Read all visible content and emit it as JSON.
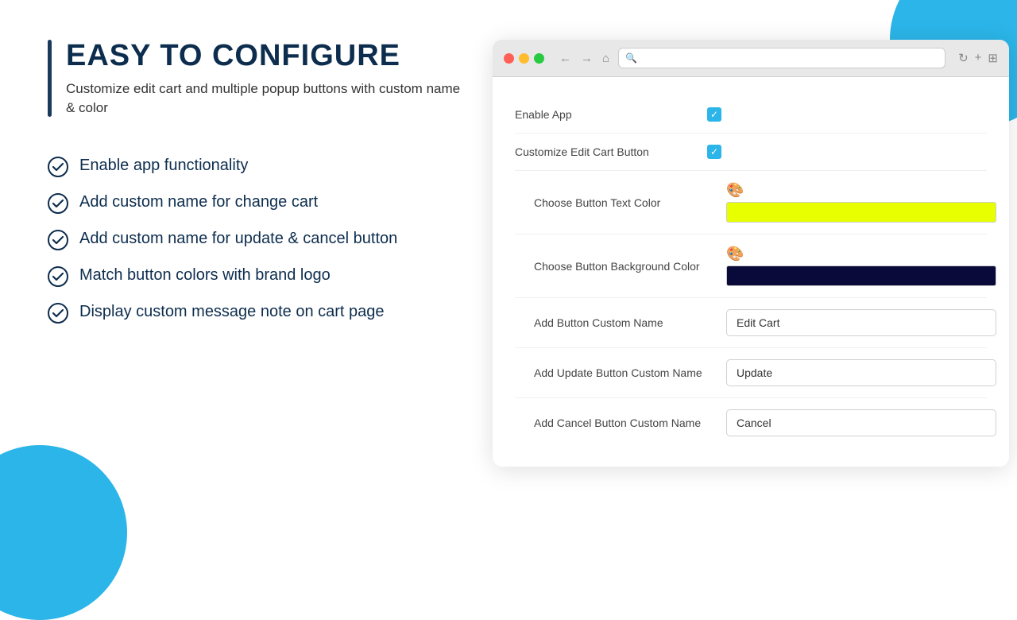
{
  "page": {
    "title": "Easy to Configure",
    "title_display": "EASY TO CONFIGURE",
    "subtitle": "Customize edit cart and multiple popup buttons with custom name & color"
  },
  "features": [
    {
      "id": 1,
      "text": "Enable app functionality"
    },
    {
      "id": 2,
      "text": "Add custom name for change cart"
    },
    {
      "id": 3,
      "text": "Add custom name for update & cancel button"
    },
    {
      "id": 4,
      "text": "Match button colors with brand logo"
    },
    {
      "id": 5,
      "text": "Display custom message note on cart page"
    }
  ],
  "form": {
    "enable_app_label": "Enable App",
    "customize_edit_cart_label": "Customize Edit Cart Button",
    "choose_text_color_label": "Choose Button Text Color",
    "choose_bg_color_label": "Choose Button Background Color",
    "add_button_name_label": "Add Button Custom Name",
    "add_update_name_label": "Add Update Button Custom Name",
    "add_cancel_name_label": "Add Cancel Button Custom Name",
    "button_name_value": "Edit Cart",
    "update_name_value": "Update",
    "cancel_name_value": "Cancel",
    "text_color_hex": "#e8ff00",
    "bg_color_hex": "#0a0a3a"
  },
  "browser": {
    "address_placeholder": ""
  },
  "colors": {
    "accent": "#2BB5E8",
    "heading": "#0d2d4e",
    "bg_decoration": "#2BB5E8"
  },
  "icons": {
    "check": "✓",
    "back": "←",
    "forward": "→",
    "home": "⌂",
    "search": "🔍",
    "refresh": "↻",
    "plus": "+",
    "grid": "⊞",
    "color_picker": "🎨"
  }
}
